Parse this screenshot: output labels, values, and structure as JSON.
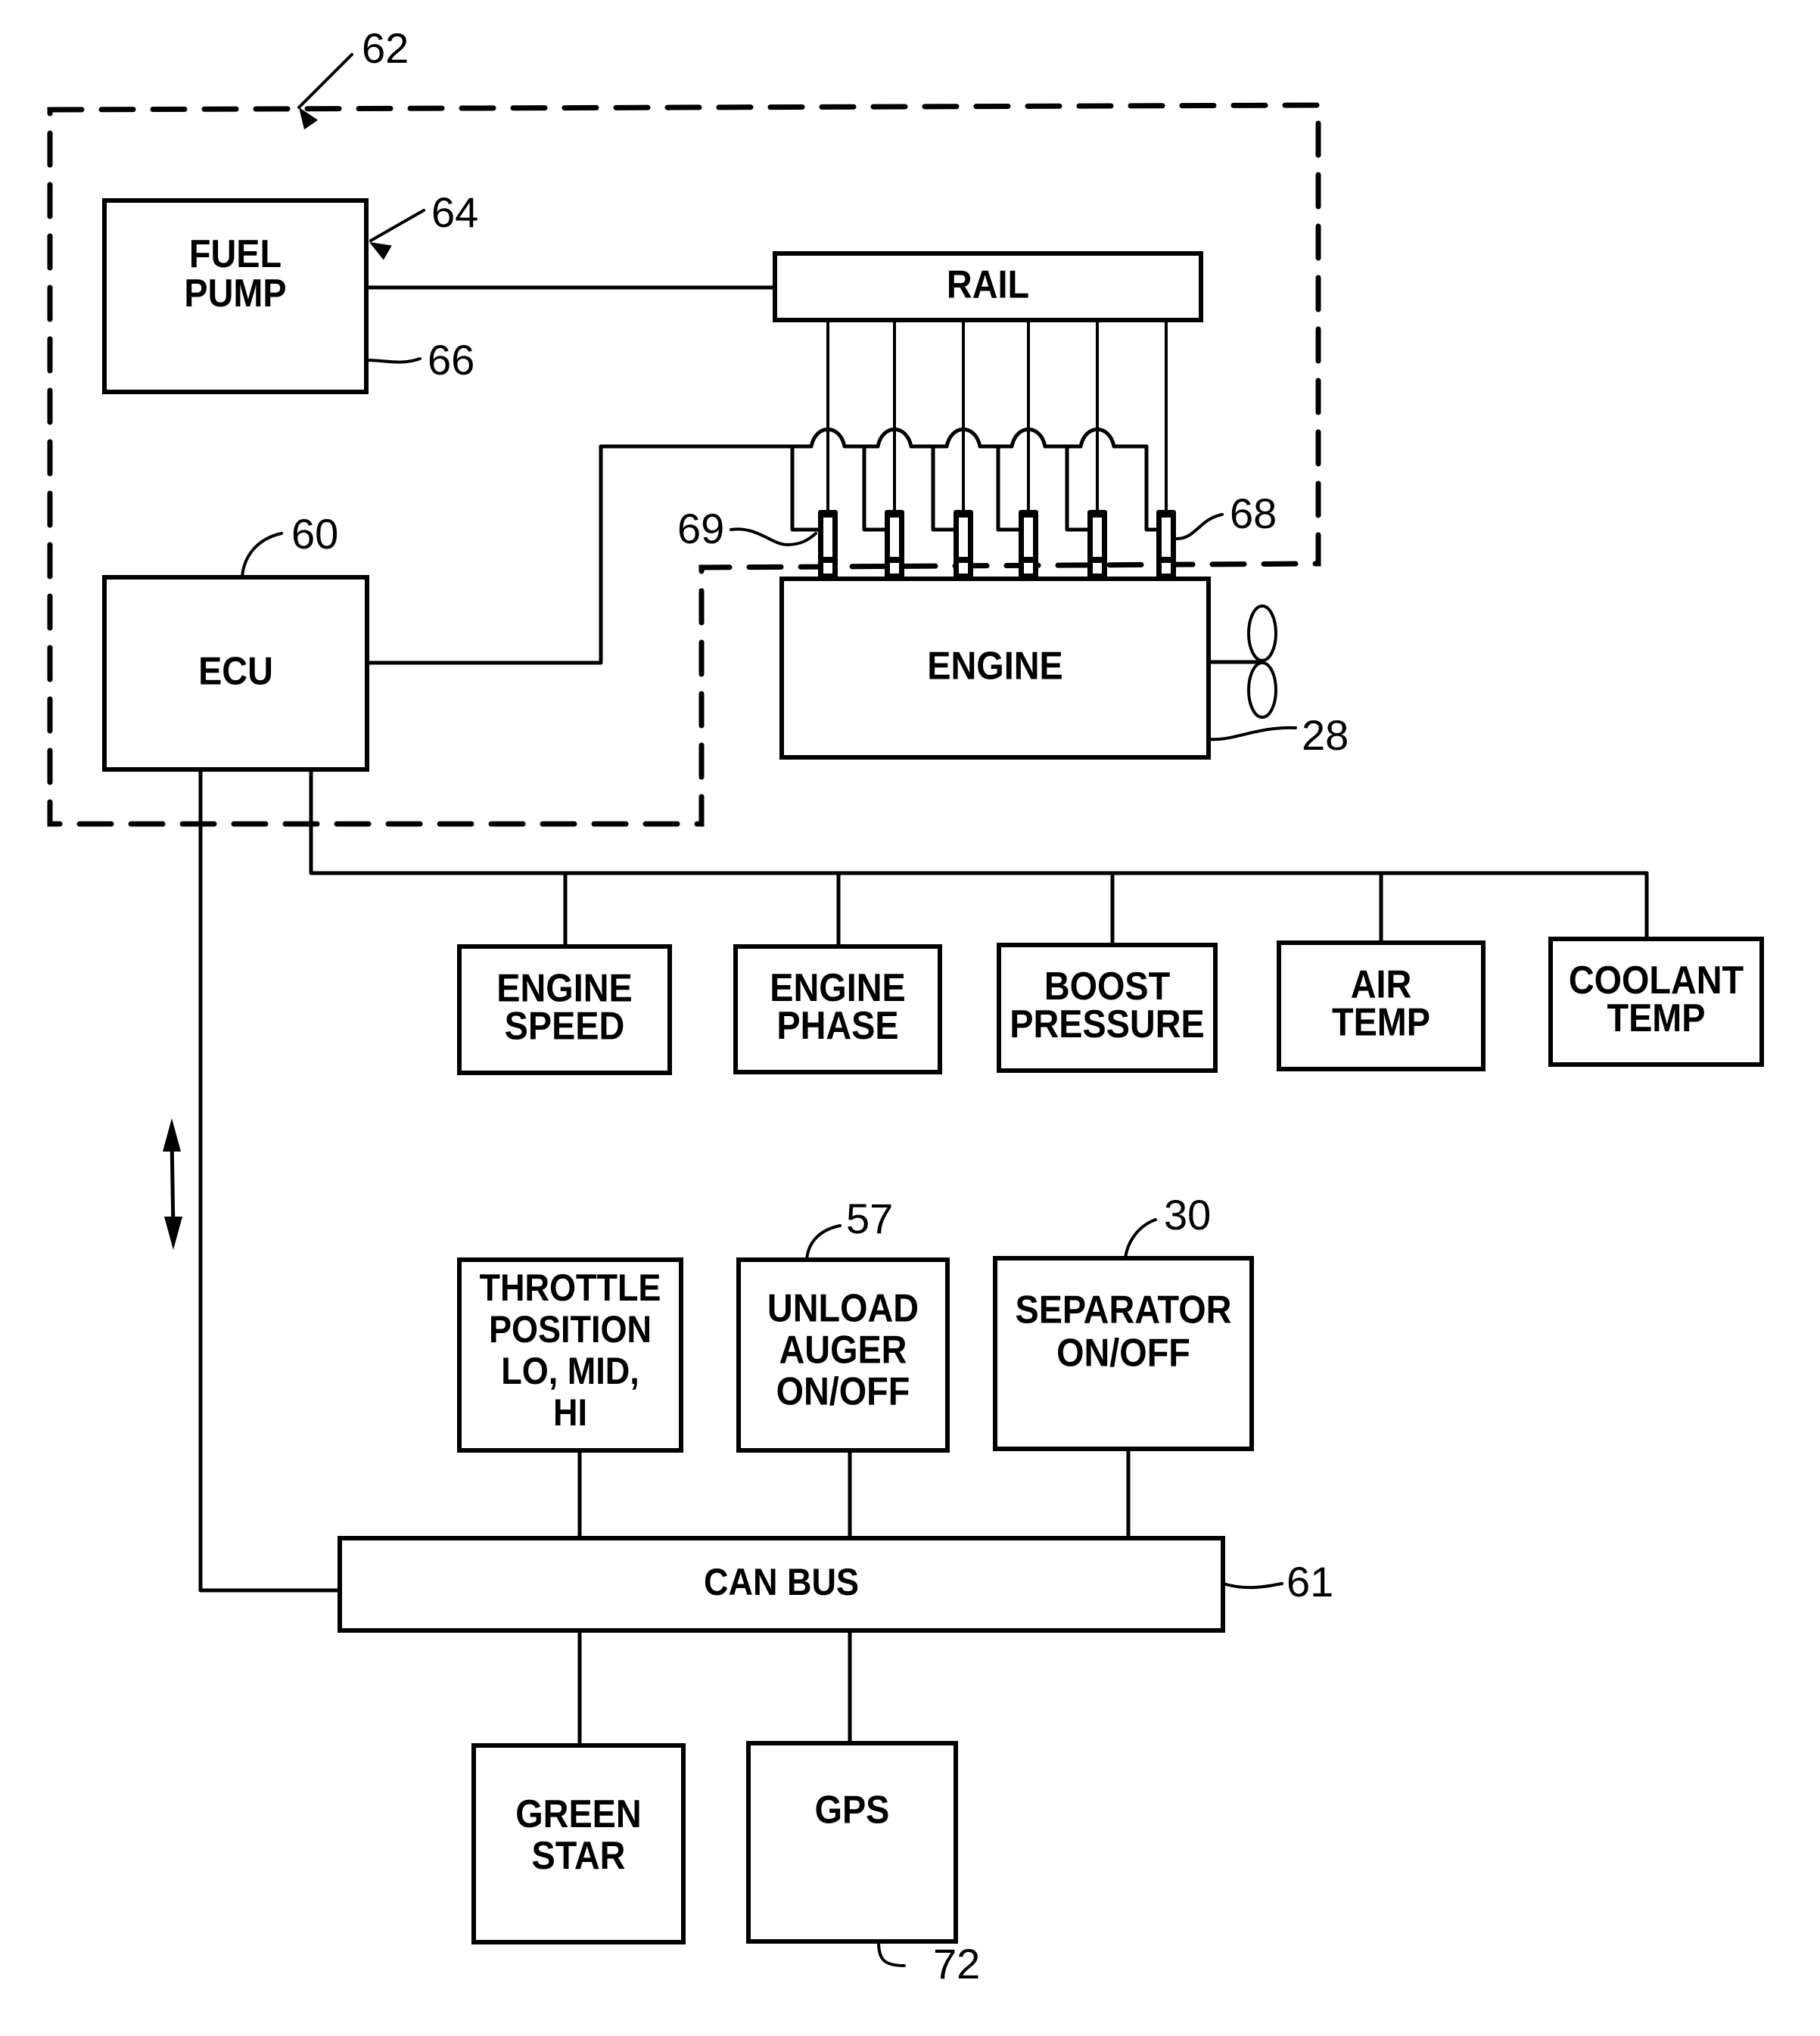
{
  "figure": {
    "type": "block-diagram",
    "subject": "Engine fuel control system with ECU, sensors and CAN bus"
  },
  "colors": {
    "line": "#000000",
    "background": "#ffffff"
  },
  "blocks": {
    "fuel_pump": {
      "lines": [
        "FUEL",
        "PUMP"
      ]
    },
    "rail": {
      "lines": [
        "RAIL"
      ]
    },
    "ecu": {
      "lines": [
        "ECU"
      ]
    },
    "engine": {
      "lines": [
        "ENGINE"
      ]
    },
    "engine_speed": {
      "lines": [
        "ENGINE",
        "SPEED"
      ]
    },
    "engine_phase": {
      "lines": [
        "ENGINE",
        "PHASE"
      ]
    },
    "boost_pressure": {
      "lines": [
        "BOOST",
        "PRESSURE"
      ]
    },
    "air_temp": {
      "lines": [
        "AIR",
        "TEMP"
      ]
    },
    "coolant_temp": {
      "lines": [
        "COOLANT",
        "TEMP"
      ]
    },
    "throttle_position": {
      "lines": [
        "THROTTLE",
        "POSITION",
        "LO, MID,",
        "HI"
      ]
    },
    "unload_auger": {
      "lines": [
        "UNLOAD",
        "AUGER",
        "ON/OFF"
      ]
    },
    "separator": {
      "lines": [
        "SEPARATOR",
        "ON/OFF"
      ]
    },
    "can_bus": {
      "lines": [
        "CAN BUS"
      ]
    },
    "green_star": {
      "lines": [
        "GREEN",
        "STAR"
      ]
    },
    "gps": {
      "lines": [
        "GPS"
      ]
    }
  },
  "reference_numerals": {
    "fuel_system_boundary": "62",
    "fuel_pump": "64",
    "fuel_pump_line": "66",
    "ecu": "60",
    "injector_wire": "69",
    "injectors": "68",
    "engine": "28",
    "unload_auger": "57",
    "separator": "30",
    "can_bus": "61",
    "gps": "72"
  },
  "injector_count": 6,
  "icons": {
    "fan": "fan-icon",
    "bidirectional_arrow": "double-arrow-icon"
  }
}
